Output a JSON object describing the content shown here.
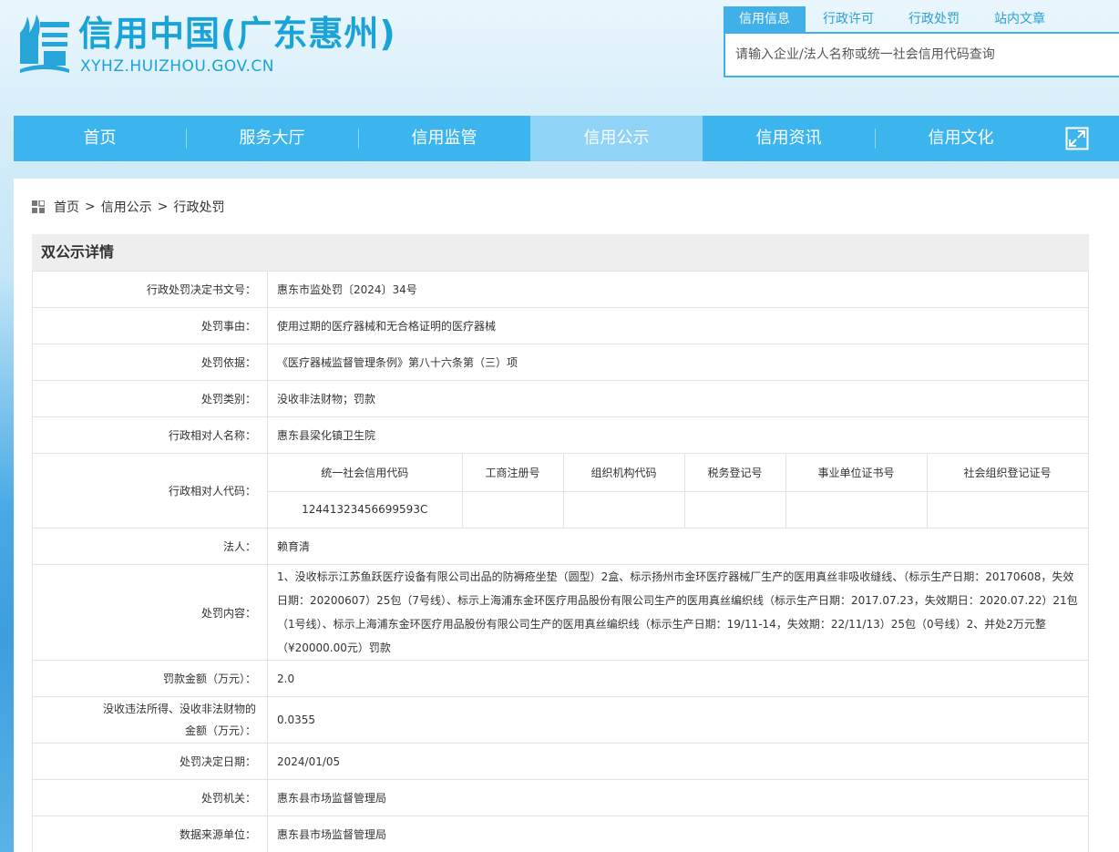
{
  "header": {
    "site_title": "信用中国(广东惠州)",
    "site_url": "XYHZ.HUIZHOU.GOV.CN",
    "search_tabs": [
      "信用信息",
      "行政许可",
      "行政处罚",
      "站内文章"
    ],
    "search_placeholder": "请输入企业/法人名称或统一社会信用代码查询"
  },
  "nav": {
    "items": [
      "首页",
      "服务大厅",
      "信用监管",
      "信用公示",
      "信用资讯",
      "信用文化"
    ],
    "active": "信用公示"
  },
  "breadcrumb": {
    "items": [
      "首页",
      "信用公示",
      "行政处罚"
    ],
    "separator": ">"
  },
  "detail": {
    "title": "双公示详情",
    "decision_no": {
      "label": "行政处罚决定书文号：",
      "value": "惠东市监处罚〔2024〕34号"
    },
    "reason": {
      "label": "处罚事由：",
      "value": "使用过期的医疗器械和无合格证明的医疗器械"
    },
    "basis": {
      "label": "处罚依据：",
      "value": "《医疗器械监督管理条例》第八十六条第（三）项"
    },
    "category": {
      "label": "处罚类别：",
      "value": "没收非法财物；罚款"
    },
    "party_name": {
      "label": "行政相对人名称：",
      "value": "惠东县梁化镇卫生院"
    },
    "party_code": {
      "label": "行政相对人代码：",
      "headers": [
        "统一社会信用代码",
        "工商注册号",
        "组织机构代码",
        "税务登记号",
        "事业单位证书号",
        "社会组织登记证号"
      ],
      "values": [
        "12441323456699593C",
        "",
        "",
        "",
        "",
        ""
      ]
    },
    "legal_person": {
      "label": "法人：",
      "value": "赖育清"
    },
    "content": {
      "label": "处罚内容：",
      "value": "1、没收标示江苏鱼跃医疗设备有限公司出品的防褥疮坐垫（圆型）2盒、标示扬州市金环医疗器械厂生产的医用真丝非吸收缝线、（标示生产日期：20170608，失效日期：20200607）25包（7号线）、标示上海浦东金环医疗用品股份有限公司生产的医用真丝编织线（标示生产日期：2017.07.23，失效期日：2020.07.22）21包（1号线）、标示上海浦东金环医疗用品股份有限公司生产的医用真丝编织线（标示生产日期：19/11-14，失效期：22/11/13）25包（0号线）2、并处2万元整（¥20000.00元）罚款"
    },
    "fine": {
      "label": "罚款金额（万元）：",
      "value": "2.0"
    },
    "confiscation": {
      "label_line1": "没收违法所得、没收非法财物的",
      "label_line2": "金额（万元）：",
      "value": "0.0355"
    },
    "decision_date": {
      "label": "处罚决定日期：",
      "value": "2024/01/05"
    },
    "authority": {
      "label": "处罚机关：",
      "value": "惠东县市场监督管理局"
    },
    "source": {
      "label": "数据来源单位：",
      "value": "惠东县市场监督管理局"
    }
  },
  "colors": {
    "brand": "#1aa3d6",
    "nav_bg": "#3cb5ee",
    "nav_active": "#8fd3f7"
  }
}
